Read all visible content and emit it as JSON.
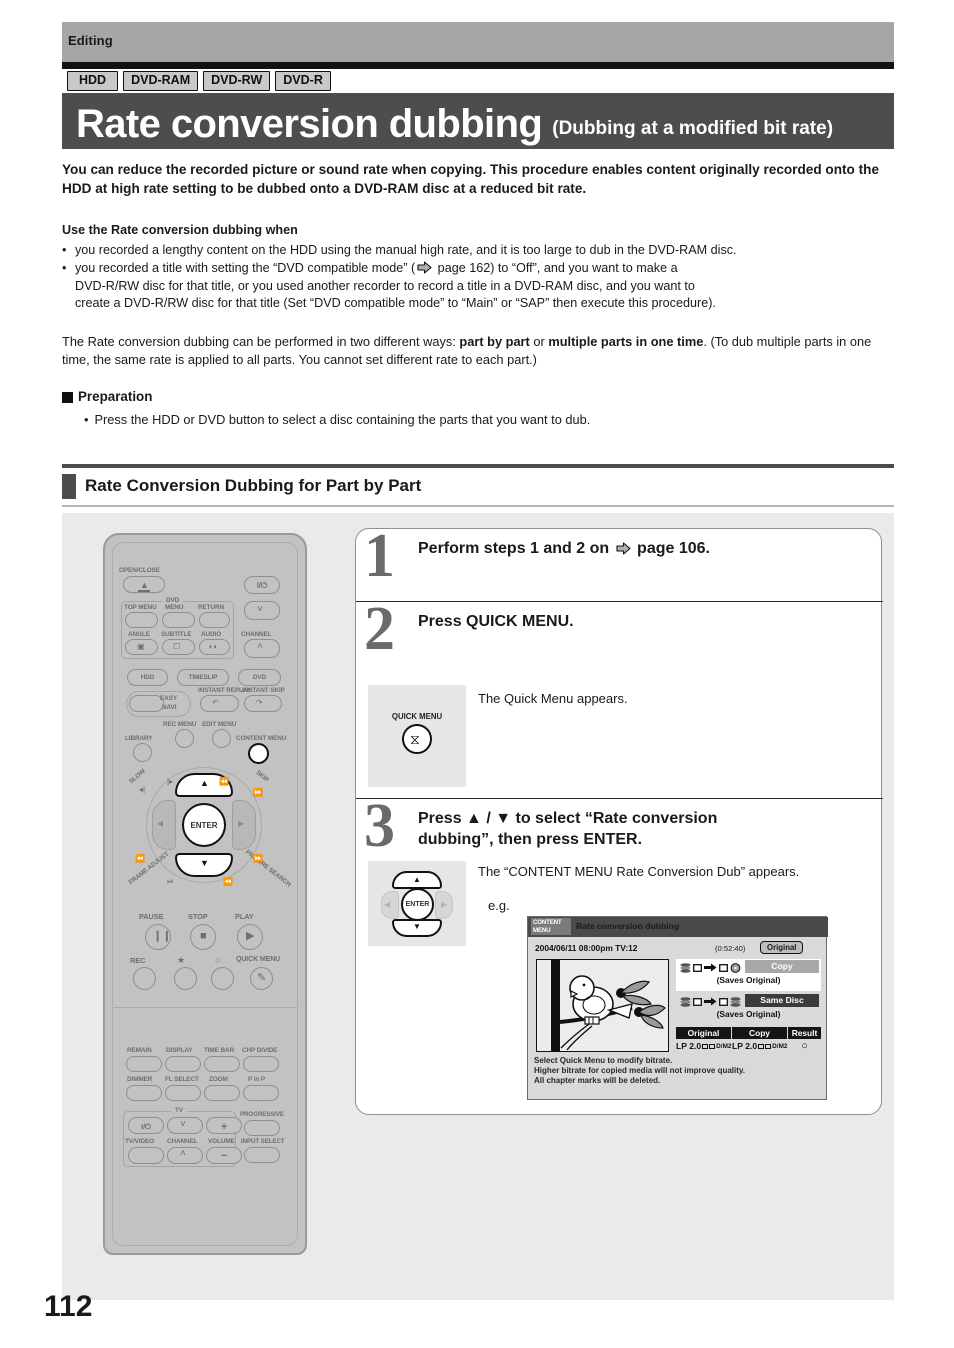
{
  "header": {
    "running_head": "Editing"
  },
  "badges": [
    {
      "label": "HDD"
    },
    {
      "label": "DVD-RAM"
    },
    {
      "label": "DVD-RW"
    },
    {
      "label": "DVD-R"
    }
  ],
  "title": {
    "main": "Rate conversion dubbing",
    "sub": "(Dubbing at a modified bit rate)"
  },
  "lead": "You can reduce the recorded picture or sound rate when copying. This procedure enables content originally recorded onto the HDD at high rate setting to be dubbed onto a DVD-RAM disc at a reduced bit rate.",
  "use_when": {
    "heading": "Use the Rate conversion dubbing when",
    "bullets": [
      "you recorded a lengthy content on the HDD using the manual high rate, and it is too large to dub in the DVD-RAM disc.",
      "you recorded a title with setting the “DVD compatible mode” ( page 162) to “Off”, and you want to make a DVD-R/RW disc for that title, or you used another recorder to record a title in a DVD-RAM disc, and you want to create a DVD-R/RW disc for that title (Set “DVD compatible mode” to “Main” or “SAP” then execute this procedure)."
    ],
    "bullet2_pre": "you recorded a title with setting the “DVD compatible mode” (",
    "bullet2_post": " page 162) to “Off”, and you want to make a",
    "bullet2_line2": "DVD-R/RW disc for that title, or you used another recorder to record a title in a DVD-RAM disc, and you want to",
    "bullet2_line3": "create a DVD-R/RW disc for that title (Set “DVD compatible mode” to “Main” or “SAP” then execute this procedure)."
  },
  "ways_para": {
    "p1": "The Rate conversion dubbing can be performed in two different ways: ",
    "b1": "part by part",
    "mid": " or ",
    "b2": "multiple parts in one time",
    "p2": ". (To dub multiple parts in one time, the same rate is applied to all parts. You cannot set different rate to each part.)"
  },
  "preparation": {
    "heading": "Preparation",
    "bullet": "Press the HDD or DVD button to select a disc containing the parts that you want to dub."
  },
  "section": {
    "heading": "Rate Conversion Dubbing for Part by Part"
  },
  "steps": [
    {
      "number": "1",
      "head_pre": "Perform steps 1 and 2 on ",
      "head_post": " page 106."
    },
    {
      "number": "2",
      "head": "Press QUICK MENU.",
      "note": "The Quick Menu appears.",
      "keycap_label": "QUICK MENU"
    },
    {
      "number": "3",
      "head_line1": "Press ▲ / ▼ to select “Rate conversion",
      "head_line2": "dubbing”, then press ENTER.",
      "note": "The “CONTENT MENU Rate Conversion Dub” appears.",
      "eg_label": "e.g.",
      "keycap_label": "ENTER"
    }
  ],
  "tv_screen": {
    "logo_line1": "CONTENT",
    "logo_line2": "MENU",
    "title": "Rate conversion dubbing",
    "meta": "2004/06/11  08:00pm  TV:12",
    "duration": "(0:52:40)",
    "original_badge": "Original",
    "options": [
      {
        "action": "Copy",
        "sub": "(Saves Original)"
      },
      {
        "action": "Same Disc",
        "sub": "(Saves Original)"
      }
    ],
    "rate_table": {
      "headers": [
        "Original",
        "Copy",
        "Result"
      ],
      "original_rate": "LP 2.0",
      "original_flag": "D/M2",
      "copy_rate": "LP 2.0",
      "copy_flag": "D/M2",
      "result": "○"
    },
    "footnotes": [
      "Select Quick Menu to modify bitrate.",
      "Higher bitrate for copied media will not improve quality.",
      "All chapter marks will be deleted."
    ]
  },
  "remote": {
    "labels": {
      "open_close": "OPEN/CLOSE",
      "dvd": "DVD",
      "top_menu": "TOP MENU",
      "menu": "MENU",
      "return": "RETURN",
      "angle": "ANGLE",
      "subtitle": "SUBTITLE",
      "audio": "AUDIO",
      "channel": "CHANNEL",
      "hdd": "HDD",
      "timeslip": "TIMESLIP",
      "dvd_btn": "DVD",
      "easy_navi_1": "EASY",
      "easy_navi_2": "NAVI",
      "instant_replay": "INSTANT REPLAY",
      "instant_skip": "INSTANT SKIP",
      "rec_menu": "REC MENU",
      "edit_menu": "EDIT MENU",
      "library": "LIBRARY",
      "content_menu": "CONTENT MENU",
      "slow": "SLOW",
      "skip": "SKIP",
      "frame_adjust": "FRAME ADJUST",
      "picture_search": "PICTURE SEARCH",
      "enter": "ENTER",
      "pause": "PAUSE",
      "stop": "STOP",
      "play": "PLAY",
      "rec": "REC",
      "quick_menu": "QUICK MENU",
      "remain": "REMAIN",
      "display": "DISPLAY",
      "time_bar": "TIME BAR",
      "chp_divide": "CHP DIVIDE",
      "dimmer": "DIMMER",
      "fl_select": "FL SELECT",
      "zoom": "ZOOM",
      "p_in_p": "P in P",
      "tv": "TV",
      "tv_video": "TV/VIDEO",
      "tv_channel": "CHANNEL",
      "volume": "VOLUME",
      "progressive": "PROGRESSIVE",
      "input_select": "INPUT SELECT",
      "power": "I/⏻",
      "plus": "+",
      "minus": "−"
    }
  },
  "footer": {
    "page_number": "112"
  },
  "colors": {
    "title_bar": "#4d4d4d",
    "running_head": "#a6a6a6",
    "panel": "#eaeaea",
    "remote_body": "#c2c2c2"
  }
}
